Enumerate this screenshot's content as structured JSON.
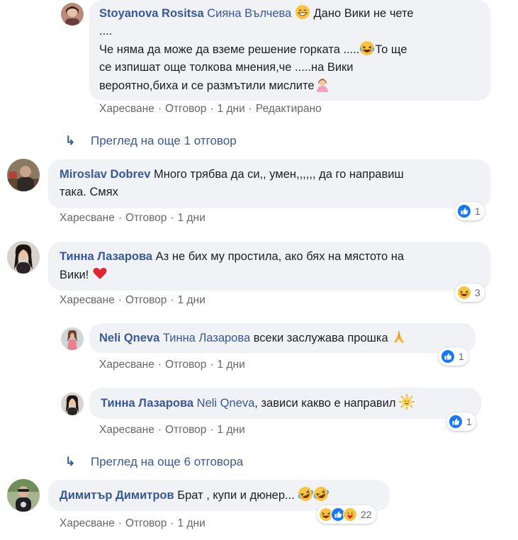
{
  "actions": {
    "like": "Харесване",
    "reply": "Отговор",
    "sep": "·",
    "edited": "Редактирано"
  },
  "comments": [
    {
      "author": "Stoyanova Rositsa",
      "mention": "Сияна Вълчева",
      "line1": "Дано Вики не чете",
      "line2": "....",
      "line3": "Че няма да може да вземе решение горката .....",
      "line3b": "То ще",
      "line4": "се изпишат още толкова мнения,че .....на Вики",
      "line5": "вероятно,биха и се размътили мислите",
      "time": "1 дни"
    },
    {
      "view_more": "Преглед на още 1 отговор"
    },
    {
      "author": "Miroslav Dobrev",
      "line1": "Много трябва да си,, умен,,,,,, да го направиш",
      "line2": "така. Смях",
      "time": "1 дни",
      "reaction_count": "1"
    },
    {
      "author": "Тинна Лазарова",
      "line1": "Аз не бих му простила, ако бях на мястото на",
      "line2": "Вики!",
      "time": "1 дни",
      "reaction_count": "3"
    },
    {
      "author": "Neli Qneva",
      "mention": "Тинна Лазарова",
      "text": "всеки заслужава прошка",
      "time": "1 дни",
      "reaction_count": "1"
    },
    {
      "author": "Тинна Лазарова",
      "mention": "Neli Qneva",
      "text": ", зависи какво е направил",
      "time": "1 дни",
      "reaction_count": "1"
    },
    {
      "view_more": "Преглед на още 6 отговора"
    },
    {
      "author": "Димитър Димитров",
      "text": "Брат , купи и дюнер...",
      "time": "1 дни",
      "reaction_count": "22"
    }
  ],
  "colors": {
    "link": "#385898",
    "bubble": "#f0f2f5",
    "meta": "#65676b",
    "like_blue": "#1877f2",
    "emoji_yellow": "#f7c443"
  }
}
